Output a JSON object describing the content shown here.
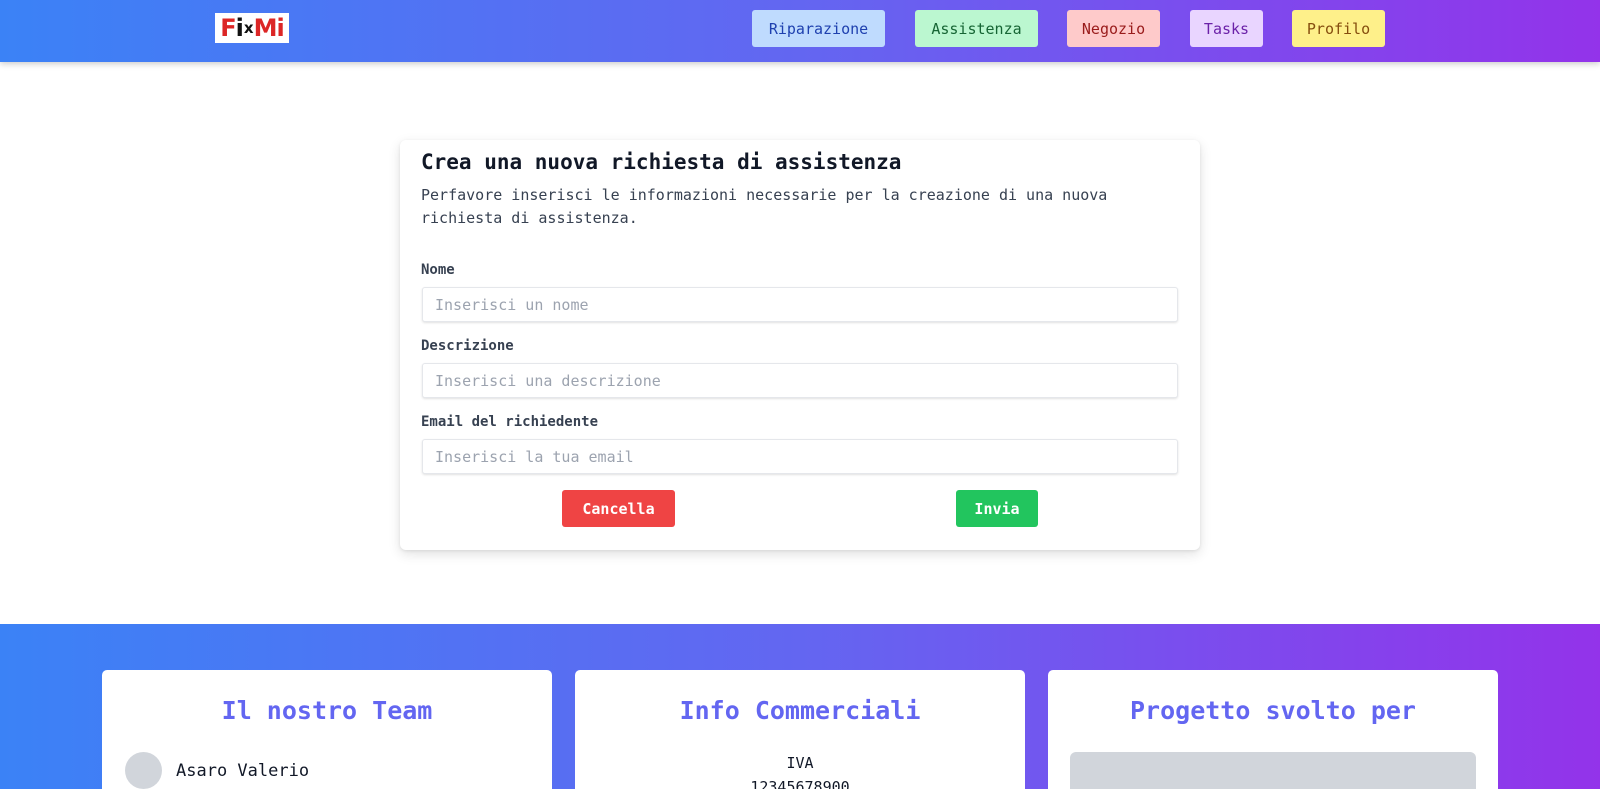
{
  "header": {
    "logo": "FixMi",
    "nav": {
      "riparazione": "Riparazione",
      "assistenza": "Assistenza",
      "negozio": "Negozio",
      "tasks": "Tasks",
      "profilo": "Profilo"
    }
  },
  "form": {
    "title": "Crea una nuova richiesta di assistenza",
    "subtitle": "Perfavore inserisci le informazioni necessarie per la creazione di una nuova richiesta di assistenza.",
    "fields": {
      "nome": {
        "label": "Nome",
        "placeholder": "Inserisci un nome",
        "value": ""
      },
      "descrizione": {
        "label": "Descrizione",
        "placeholder": "Inserisci una descrizione",
        "value": ""
      },
      "email": {
        "label": "Email del richiedente",
        "placeholder": "Inserisci la tua email",
        "value": ""
      }
    },
    "buttons": {
      "cancel": "Cancella",
      "submit": "Invia"
    }
  },
  "footer": {
    "team": {
      "title": "Il nostro Team",
      "members": [
        {
          "name": "Asaro Valerio"
        }
      ]
    },
    "info": {
      "title": "Info Commerciali",
      "iva_label": "IVA",
      "iva_value": "12345678900"
    },
    "project": {
      "title": "Progetto svolto per"
    }
  },
  "colors": {
    "gradient_start": "#3b82f6",
    "gradient_end": "#9333ea",
    "cancel": "#ef4444",
    "submit": "#22c55e",
    "footer_title": "#6366f1"
  }
}
